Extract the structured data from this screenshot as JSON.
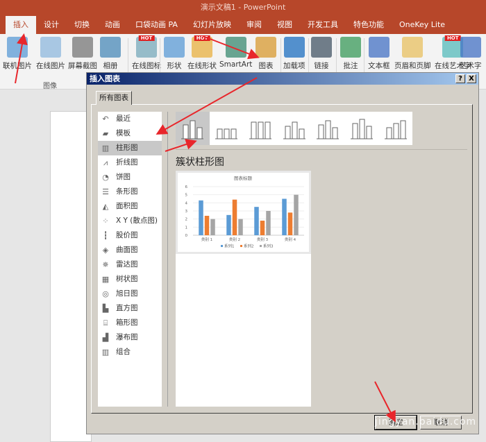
{
  "window": {
    "title": "演示文稿1 - PowerPoint"
  },
  "tabs": [
    "插入",
    "设计",
    "切换",
    "动画",
    "口袋动画 PA",
    "幻灯片放映",
    "审阅",
    "视图",
    "开发工具",
    "特色功能",
    "OneKey Lite"
  ],
  "ribbon": {
    "buttons": [
      {
        "label": "联机图片",
        "icon": "online-picture-icon"
      },
      {
        "label": "在线图片",
        "icon": "cloud-picture-icon"
      },
      {
        "label": "屏幕截图",
        "icon": "screenshot-icon"
      },
      {
        "label": "相册",
        "icon": "album-icon"
      },
      {
        "label": "在线图标",
        "icon": "online-icon",
        "hot": "HOT"
      },
      {
        "label": "形状",
        "icon": "shapes-icon"
      },
      {
        "label": "在线形状",
        "icon": "online-shapes-icon",
        "hot": "HOT"
      },
      {
        "label": "SmartArt",
        "icon": "smartart-icon"
      },
      {
        "label": "图表",
        "icon": "chart-icon"
      },
      {
        "label": "加载项",
        "icon": "addin-icon"
      },
      {
        "label": "链接",
        "icon": "link-icon"
      },
      {
        "label": "批注",
        "icon": "comment-icon"
      },
      {
        "label": "文本框",
        "icon": "textbox-icon"
      },
      {
        "label": "页眉和页脚",
        "icon": "header-footer-icon"
      },
      {
        "label": "在线艺术字",
        "icon": "online-wordart-icon",
        "hot": "HOT"
      },
      {
        "label": "艺术字",
        "icon": "wordart-icon"
      }
    ],
    "group_label": "图像"
  },
  "dialog": {
    "title": "插入图表",
    "help": "?",
    "close": "X",
    "tab": "所有图表",
    "categories": [
      {
        "label": "最近",
        "icon": "↶"
      },
      {
        "label": "模板",
        "icon": "▰"
      },
      {
        "label": "柱形图",
        "icon": "▥"
      },
      {
        "label": "折线图",
        "icon": "⩘"
      },
      {
        "label": "饼图",
        "icon": "◔"
      },
      {
        "label": "条形图",
        "icon": "☰"
      },
      {
        "label": "面积图",
        "icon": "◭"
      },
      {
        "label": "X Y (散点图)",
        "icon": "⁘"
      },
      {
        "label": "股价图",
        "icon": "┇"
      },
      {
        "label": "曲面图",
        "icon": "◈"
      },
      {
        "label": "雷达图",
        "icon": "✵"
      },
      {
        "label": "树状图",
        "icon": "▦"
      },
      {
        "label": "旭日图",
        "icon": "◎"
      },
      {
        "label": "直方图",
        "icon": "▙"
      },
      {
        "label": "箱形图",
        "icon": "⌸"
      },
      {
        "label": "瀑布图",
        "icon": "▟"
      },
      {
        "label": "组合",
        "icon": "▥"
      }
    ],
    "selected_category": 2,
    "selected_subtype_title": "簇状柱形图",
    "ok": "确定",
    "cancel": "取消"
  },
  "chart_data": {
    "type": "bar",
    "title": "图表标题",
    "categories": [
      "类别 1",
      "类别 2",
      "类别 3",
      "类别 4"
    ],
    "series": [
      {
        "name": "系列1",
        "values": [
          4.3,
          2.5,
          3.5,
          4.5
        ],
        "color": "#5b9bd5"
      },
      {
        "name": "系列2",
        "values": [
          2.4,
          4.4,
          1.8,
          2.8
        ],
        "color": "#ed7d31"
      },
      {
        "name": "系列3",
        "values": [
          2,
          2,
          3,
          5
        ],
        "color": "#a5a5a5"
      }
    ],
    "ylim": [
      0,
      6
    ],
    "yticks": [
      "0",
      "1",
      "2",
      "3",
      "4",
      "5",
      "6"
    ],
    "grid": true,
    "legend": "bottom"
  },
  "watermark": "jingyan.baidu.com",
  "colors": {
    "accent": "#b7472a",
    "arrow": "#e8262b"
  }
}
